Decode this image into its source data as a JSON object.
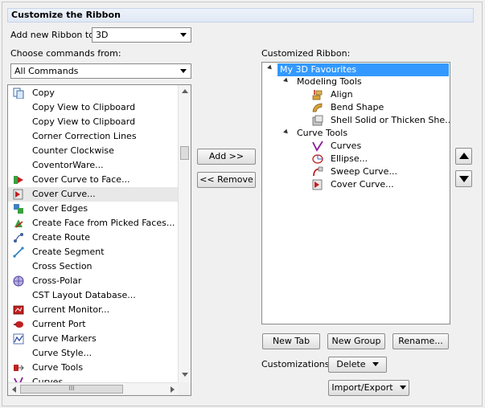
{
  "header": {
    "title": "Customize the Ribbon"
  },
  "add_new_ribbon": {
    "label": "Add new Ribbon to:",
    "value": "3D"
  },
  "choose_commands": {
    "label": "Choose commands from:",
    "value": "All Commands"
  },
  "commands": [
    {
      "label": "Copy",
      "icon": "copy-icon"
    },
    {
      "label": "Copy View to Clipboard",
      "icon": ""
    },
    {
      "label": "Copy View to Clipboard",
      "icon": ""
    },
    {
      "label": "Corner Correction Lines",
      "icon": ""
    },
    {
      "label": "Counter Clockwise",
      "icon": ""
    },
    {
      "label": "CoventorWare...",
      "icon": ""
    },
    {
      "label": "Cover Curve to Face...",
      "icon": "cover-curve-to-face-icon"
    },
    {
      "label": "Cover Curve...",
      "icon": "cover-curve-icon"
    },
    {
      "label": "Cover Edges",
      "icon": "cover-edges-icon"
    },
    {
      "label": "Create Face from Picked Faces...",
      "icon": "create-face-icon"
    },
    {
      "label": "Create Route",
      "icon": "create-route-icon"
    },
    {
      "label": "Create Segment",
      "icon": "create-segment-icon"
    },
    {
      "label": "Cross Section",
      "icon": ""
    },
    {
      "label": "Cross-Polar",
      "icon": "cross-polar-icon"
    },
    {
      "label": "CST Layout Database...",
      "icon": ""
    },
    {
      "label": "Current Monitor...",
      "icon": "current-monitor-icon"
    },
    {
      "label": "Current Port",
      "icon": "current-port-icon"
    },
    {
      "label": "Curve Markers",
      "icon": "curve-markers-icon"
    },
    {
      "label": "Curve Style...",
      "icon": ""
    },
    {
      "label": "Curve Tools",
      "icon": "curve-tools-icon"
    },
    {
      "label": "Curves",
      "icon": "curves-icon"
    }
  ],
  "selected_command_index": 7,
  "buttons": {
    "add": "Add >>",
    "remove": "<< Remove",
    "new_tab": "New Tab",
    "new_group": "New Group",
    "rename": "Rename...",
    "delete": "Delete",
    "import_export": "Import/Export"
  },
  "customized_ribbon": {
    "label": "Customized Ribbon:",
    "tab": "My 3D Favourites",
    "groups": [
      {
        "label": "Modeling Tools",
        "items": [
          "Align",
          "Bend Shape",
          "Shell Solid or Thicken She..."
        ]
      },
      {
        "label": "Curve Tools",
        "items": [
          "Curves",
          "Ellipse...",
          "Sweep Curve...",
          "Cover Curve..."
        ]
      }
    ]
  },
  "customizations": {
    "label": "Customizations:"
  },
  "colors": {
    "selection": "#3399ff",
    "header_bg": "#dfe8f5"
  }
}
